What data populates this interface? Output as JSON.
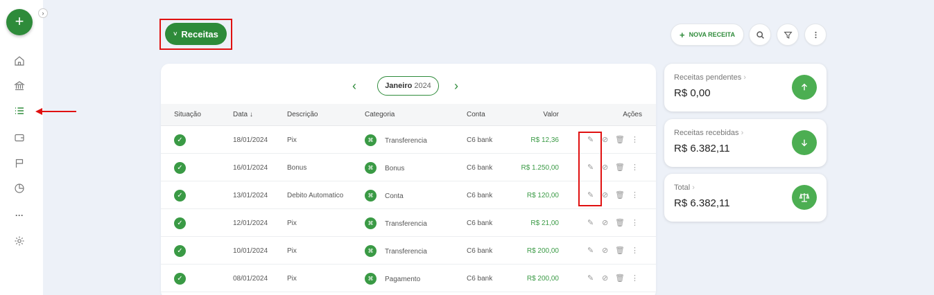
{
  "sidebar": {
    "fab_label": "+",
    "collapse_label": "›",
    "items": [
      {
        "icon": "home-icon"
      },
      {
        "icon": "bank-icon"
      },
      {
        "icon": "list-icon",
        "active": true
      },
      {
        "icon": "wallet-icon"
      },
      {
        "icon": "flag-icon"
      },
      {
        "icon": "pie-chart-icon"
      },
      {
        "icon": "more-icon",
        "label": "···"
      },
      {
        "icon": "gear-icon"
      }
    ]
  },
  "header": {
    "title": "Receitas",
    "title_chevron": "˅",
    "nova_receita_label": "NOVA RECEITA",
    "nova_receita_plus": "+"
  },
  "month": {
    "month": "Janeiro",
    "year": "2024",
    "prev": "‹",
    "next": "›"
  },
  "table": {
    "columns": {
      "situacao": "Situação",
      "data": "Data ↓",
      "descricao": "Descrição",
      "categoria": "Categoria",
      "conta": "Conta",
      "valor": "Valor",
      "acoes": "Ações"
    },
    "rows": [
      {
        "data": "18/01/2024",
        "descricao": "Pix",
        "categoria": "Transferencia",
        "conta": "C6 bank",
        "valor": "R$ 12,36"
      },
      {
        "data": "16/01/2024",
        "descricao": "Bonus",
        "categoria": "Bonus",
        "conta": "C6 bank",
        "valor": "R$ 1.250,00"
      },
      {
        "data": "13/01/2024",
        "descricao": "Debito Automatico",
        "categoria": "Conta",
        "conta": "C6 bank",
        "valor": "R$ 120,00"
      },
      {
        "data": "12/01/2024",
        "descricao": "Pix",
        "categoria": "Transferencia",
        "conta": "C6 bank",
        "valor": "R$ 21,00"
      },
      {
        "data": "10/01/2024",
        "descricao": "Pix",
        "categoria": "Transferencia",
        "conta": "C6 bank",
        "valor": "R$ 200,00"
      },
      {
        "data": "08/01/2024",
        "descricao": "Pix",
        "categoria": "Pagamento",
        "conta": "C6 bank",
        "valor": "R$ 200,00"
      }
    ]
  },
  "summary": {
    "pendentes": {
      "label": "Receitas pendentes",
      "value": "R$ 0,00",
      "icon": "arrow-up-icon"
    },
    "recebidas": {
      "label": "Receitas recebidas",
      "value": "R$ 6.382,11",
      "icon": "arrow-down-icon"
    },
    "total": {
      "label": "Total",
      "value": "R$ 6.382,11",
      "icon": "balance-scale-icon"
    }
  },
  "colors": {
    "accent": "#2e8b3a",
    "annotation": "#e01010",
    "background": "#edf1f8"
  }
}
